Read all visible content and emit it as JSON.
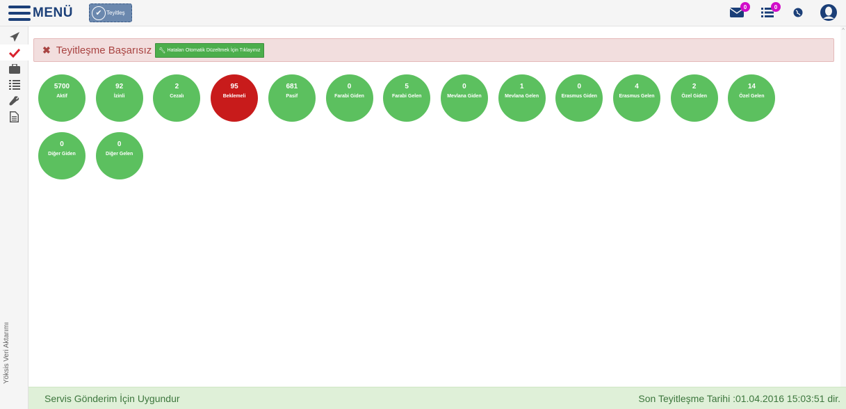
{
  "topbar": {
    "menu_label": "MENÜ",
    "status_chip_label": "Teyitleş",
    "icons": [
      {
        "name": "envelope-icon",
        "badge": "0"
      },
      {
        "name": "list-icon",
        "badge": "0"
      },
      {
        "name": "globe-icon"
      },
      {
        "name": "user-icon"
      }
    ]
  },
  "sidebar": {
    "items": [
      {
        "name": "send-icon"
      },
      {
        "name": "check-icon",
        "active": true
      },
      {
        "name": "briefcase-icon"
      },
      {
        "name": "list-ordered-icon"
      },
      {
        "name": "wrench-icon"
      },
      {
        "name": "document-icon"
      }
    ],
    "vertical_label": "Yöksis Veri Aktarımı"
  },
  "alert": {
    "title": "Teyitleşme Başarısız",
    "fix_button_label": "Hataları Otomatik Düzeltmek İçin Tıklayınız"
  },
  "stats": [
    {
      "value": "5700",
      "label": "Aktif",
      "status": "ok"
    },
    {
      "value": "92",
      "label": "İzinli",
      "status": "ok"
    },
    {
      "value": "2",
      "label": "Cezalı",
      "status": "ok"
    },
    {
      "value": "95",
      "label": "Beklemeli",
      "status": "error"
    },
    {
      "value": "681",
      "label": "Pasif",
      "status": "ok"
    },
    {
      "value": "0",
      "label": "Farabi Giden",
      "status": "ok"
    },
    {
      "value": "5",
      "label": "Farabi Gelen",
      "status": "ok"
    },
    {
      "value": "0",
      "label": "Mevlana Giden",
      "status": "ok"
    },
    {
      "value": "1",
      "label": "Mevlana Gelen",
      "status": "ok"
    },
    {
      "value": "0",
      "label": "Erasmus Giden",
      "status": "ok"
    },
    {
      "value": "4",
      "label": "Erasmus Gelen",
      "status": "ok"
    },
    {
      "value": "2",
      "label": "Özel Giden",
      "status": "ok"
    },
    {
      "value": "14",
      "label": "Özel Gelen",
      "status": "ok"
    },
    {
      "value": "0",
      "label": "Diğer Giden",
      "status": "ok"
    },
    {
      "value": "0",
      "label": "Diğer Gelen",
      "status": "ok"
    }
  ],
  "footer": {
    "left_text": "Servis Gönderim İçin Uygundur",
    "right_text": "Son Teyitleşme Tarihi :01.04.2016 15:03:51 dir."
  },
  "colors": {
    "brand": "#1b3f78",
    "ok": "#5cc05f",
    "error": "#c81b1b",
    "alert_bg": "#f2dede",
    "footer_bg": "#dff0d8",
    "badge": "#d10cc9"
  }
}
